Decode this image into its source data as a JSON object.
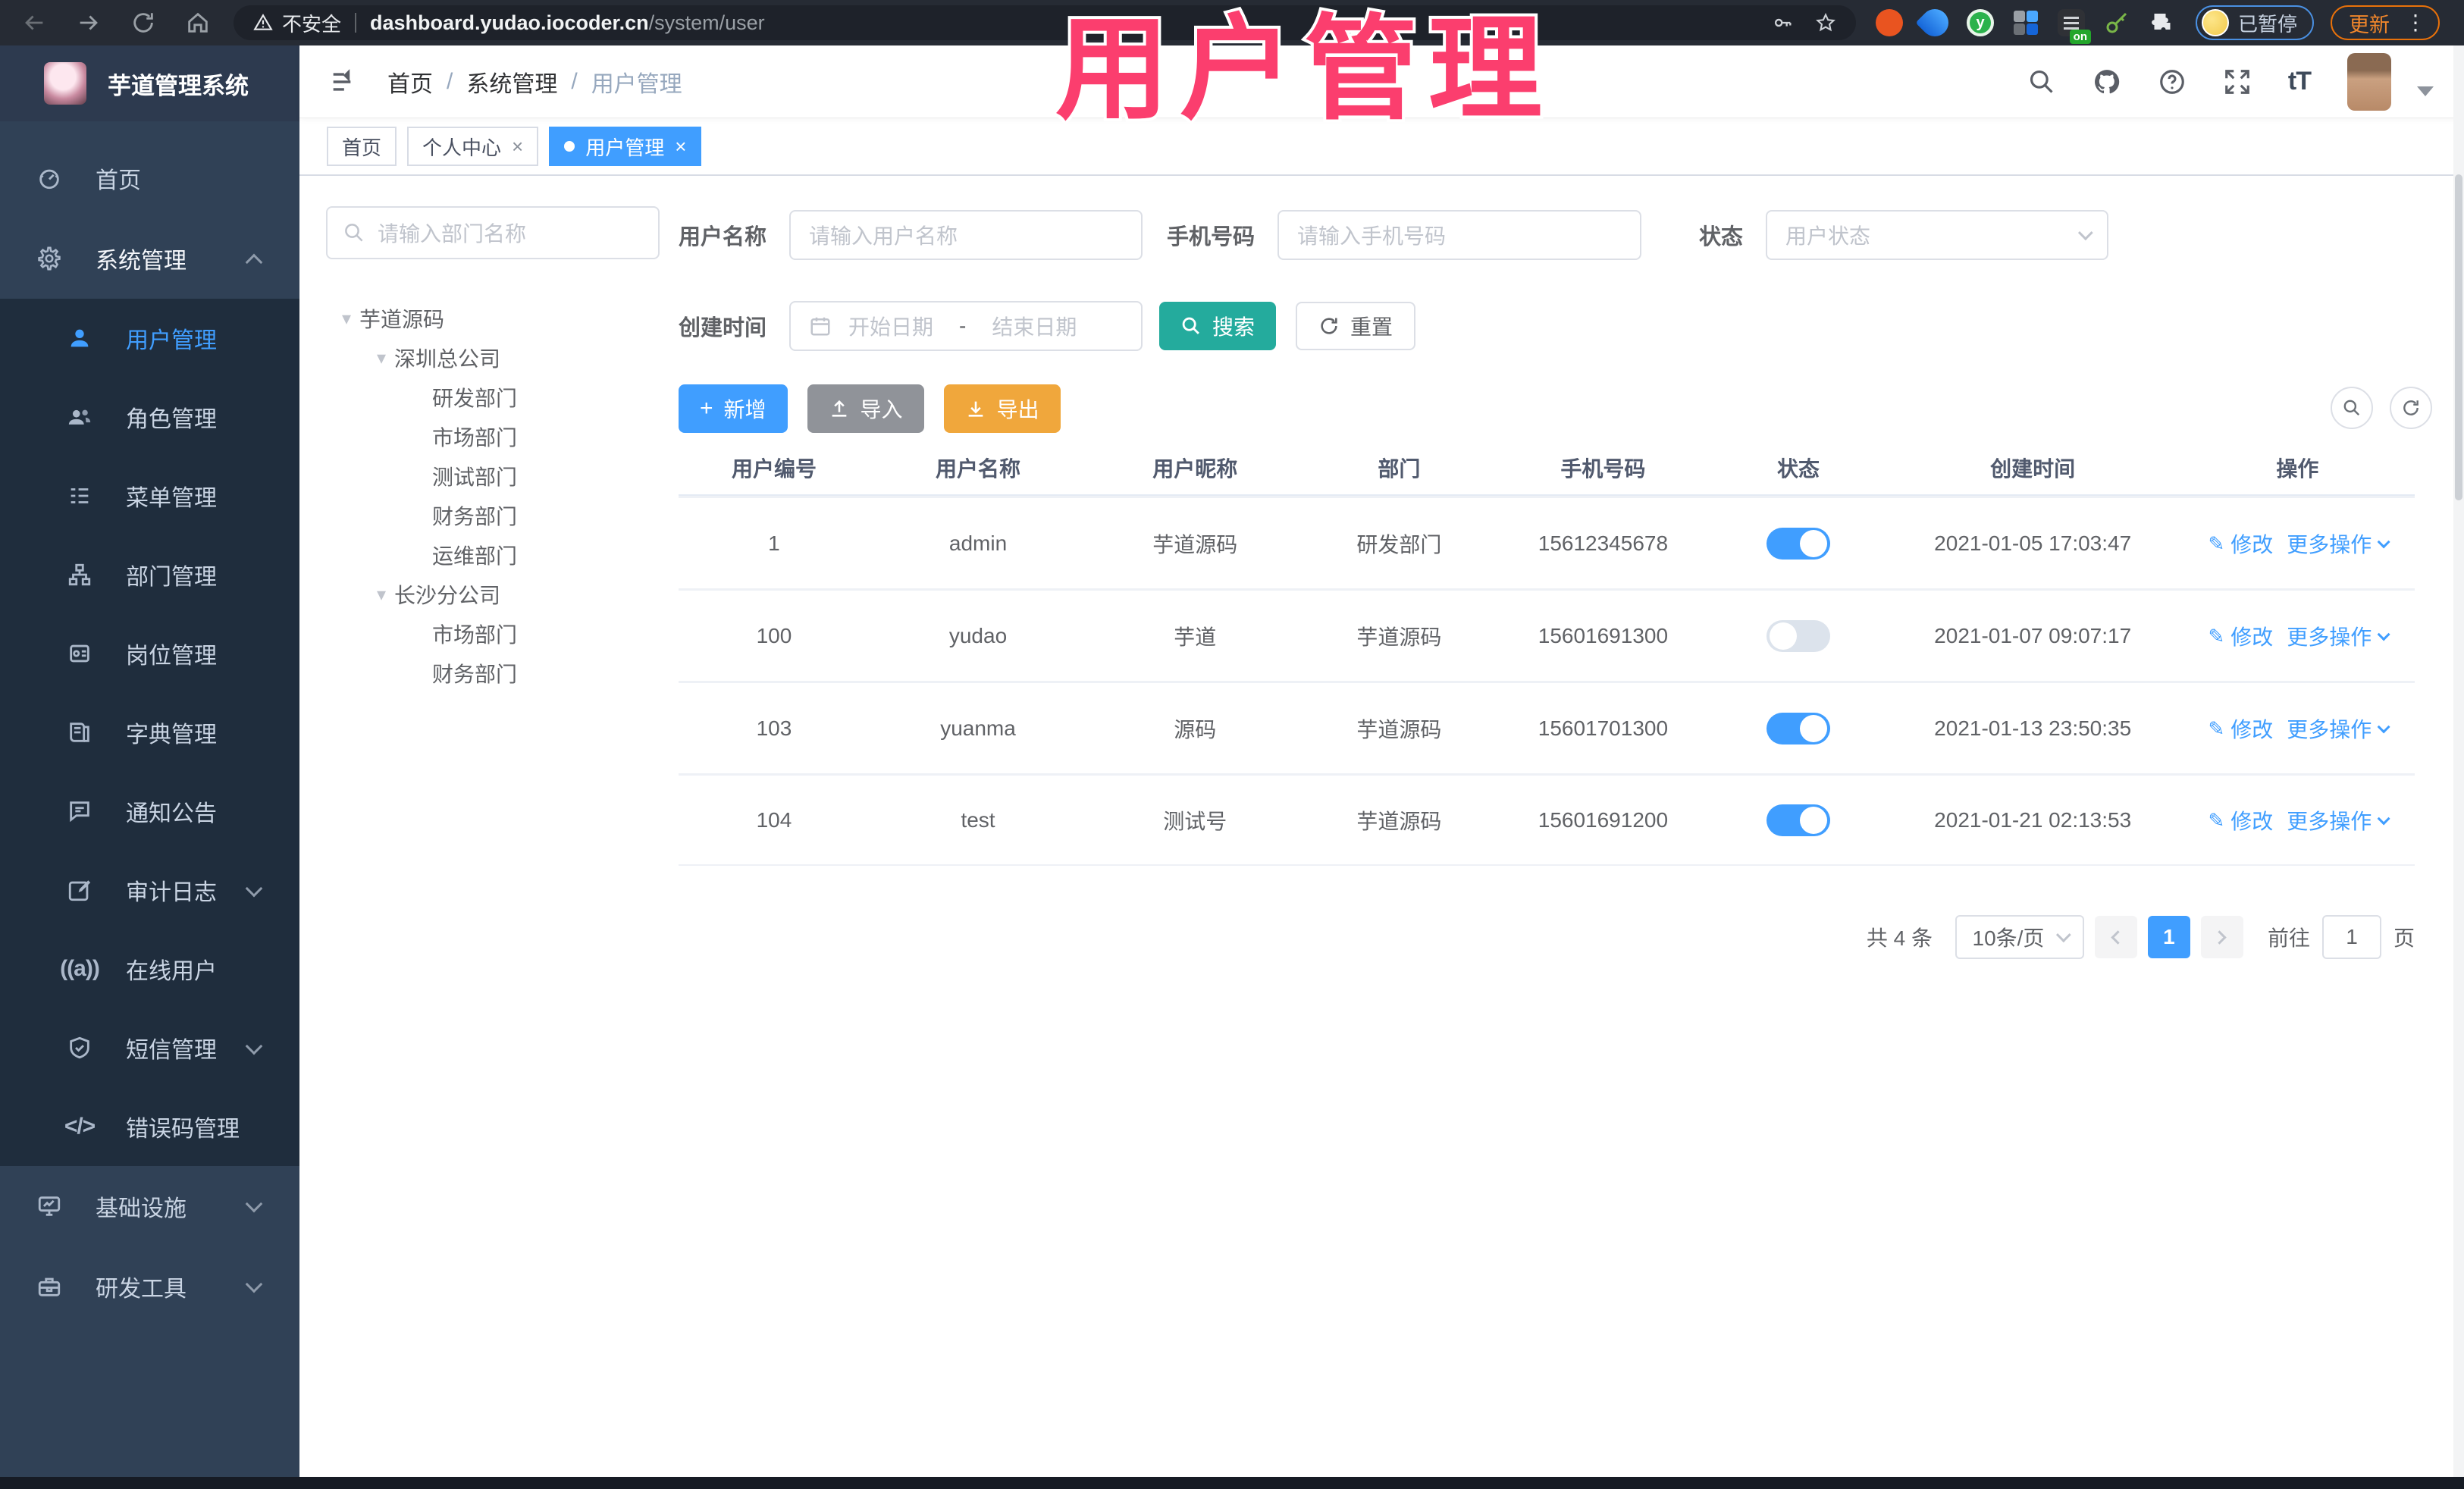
{
  "browser": {
    "security_warning": "不安全",
    "url_host": "dashboard.yudao.iocoder.cn",
    "url_path": "/system/user",
    "profile_status": "已暂停",
    "update_label": "更新",
    "extension_on_badge": "on"
  },
  "overlay": {
    "title": "用户管理"
  },
  "app": {
    "name": "芋道管理系统"
  },
  "breadcrumb": {
    "items": [
      "首页",
      "系统管理",
      "用户管理"
    ],
    "separator": "/"
  },
  "tabs": [
    {
      "label": "首页",
      "closable": false,
      "active": false
    },
    {
      "label": "个人中心",
      "closable": true,
      "active": false
    },
    {
      "label": "用户管理",
      "closable": true,
      "active": true
    }
  ],
  "header_icons": {
    "text_size_label": "tT"
  },
  "sidebar": {
    "items": [
      {
        "label": "首页",
        "level": 1,
        "active": false
      },
      {
        "label": "系统管理",
        "level": 1,
        "expanded": true
      },
      {
        "label": "用户管理",
        "level": 2,
        "active": true
      },
      {
        "label": "角色管理",
        "level": 2
      },
      {
        "label": "菜单管理",
        "level": 2
      },
      {
        "label": "部门管理",
        "level": 2
      },
      {
        "label": "岗位管理",
        "level": 2
      },
      {
        "label": "字典管理",
        "level": 2
      },
      {
        "label": "通知公告",
        "level": 2
      },
      {
        "label": "审计日志",
        "level": 2,
        "collapsed": true
      },
      {
        "label": "在线用户",
        "level": 2
      },
      {
        "label": "短信管理",
        "level": 2,
        "collapsed": true
      },
      {
        "label": "错误码管理",
        "level": 2
      },
      {
        "label": "基础设施",
        "level": 1,
        "collapsed": true
      },
      {
        "label": "研发工具",
        "level": 1,
        "collapsed": true
      }
    ]
  },
  "tree": {
    "search_placeholder": "请输入部门名称",
    "nodes": [
      {
        "label": "芋道源码",
        "level": 0,
        "expandable": true
      },
      {
        "label": "深圳总公司",
        "level": 1,
        "expandable": true
      },
      {
        "label": "研发部门",
        "level": 2
      },
      {
        "label": "市场部门",
        "level": 2
      },
      {
        "label": "测试部门",
        "level": 2
      },
      {
        "label": "财务部门",
        "level": 2
      },
      {
        "label": "运维部门",
        "level": 2
      },
      {
        "label": "长沙分公司",
        "level": 1,
        "expandable": true
      },
      {
        "label": "市场部门",
        "level": 2
      },
      {
        "label": "财务部门",
        "level": 2
      }
    ]
  },
  "filters": {
    "username_label": "用户名称",
    "username_placeholder": "请输入用户名称",
    "mobile_label": "手机号码",
    "mobile_placeholder": "请输入手机号码",
    "status_label": "状态",
    "status_placeholder": "用户状态",
    "create_time_label": "创建时间",
    "date_start_placeholder": "开始日期",
    "date_separator": "-",
    "date_end_placeholder": "结束日期",
    "search_label": "搜索",
    "reset_label": "重置"
  },
  "toolbar": {
    "add_label": "新增",
    "import_label": "导入",
    "export_label": "导出"
  },
  "table": {
    "columns": [
      "用户编号",
      "用户名称",
      "用户昵称",
      "部门",
      "手机号码",
      "状态",
      "创建时间",
      "操作"
    ],
    "action_edit": "修改",
    "action_more": "更多操作",
    "rows": [
      {
        "id": "1",
        "username": "admin",
        "nickname": "芋道源码",
        "dept": "研发部门",
        "mobile": "15612345678",
        "status": true,
        "created": "2021-01-05 17:03:47"
      },
      {
        "id": "100",
        "username": "yudao",
        "nickname": "芋道",
        "dept": "芋道源码",
        "mobile": "15601691300",
        "status": false,
        "created": "2021-01-07 09:07:17"
      },
      {
        "id": "103",
        "username": "yuanma",
        "nickname": "源码",
        "dept": "芋道源码",
        "mobile": "15601701300",
        "status": true,
        "created": "2021-01-13 23:50:35"
      },
      {
        "id": "104",
        "username": "test",
        "nickname": "测试号",
        "dept": "芋道源码",
        "mobile": "15601691200",
        "status": true,
        "created": "2021-01-21 02:13:53"
      }
    ]
  },
  "pagination": {
    "total_label": "共 4 条",
    "page_size_label": "10条/页",
    "current_page": "1",
    "goto_label": "前往",
    "goto_value": "1",
    "page_unit_label": "页"
  },
  "colors": {
    "accent_blue": "#409eff",
    "search_teal": "#24ab9d",
    "export_orange": "#f0a73c",
    "import_gray": "#909399",
    "overlay_pink": "#fb3e6e",
    "sidebar_bg": "#304156",
    "submenu_bg": "#1f2d3d",
    "update_orange": "#e8710a",
    "profile_badge_blue": "#4a90e2"
  }
}
